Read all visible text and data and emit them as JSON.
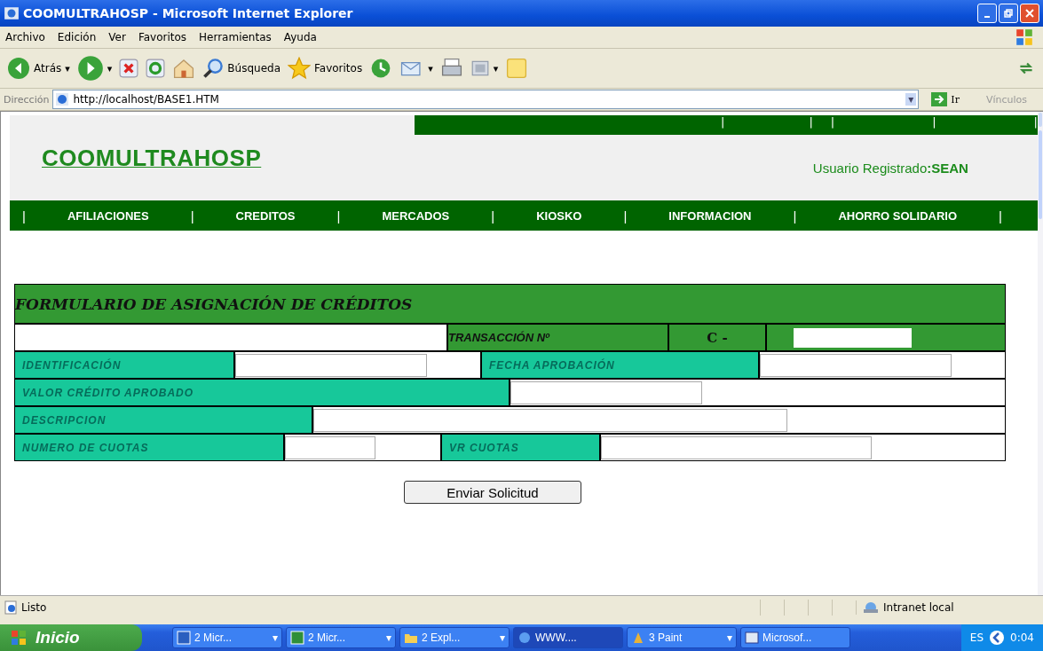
{
  "window": {
    "title": "COOMULTRAHOSP - Microsoft Internet Explorer"
  },
  "menu": [
    "Archivo",
    "Edición",
    "Ver",
    "Favoritos",
    "Herramientas",
    "Ayuda"
  ],
  "toolbar": {
    "back": "Atrás",
    "back_caret": "▾",
    "forward_caret": "▾",
    "search": "Búsqueda",
    "favorites": "Favoritos",
    "mail_caret": "▾",
    "window_caret": "▾"
  },
  "address": {
    "label": "Dirección",
    "value": "http://localhost/BASE1.HTM",
    "dropdown": "▾",
    "go": "Ir",
    "links": "Vínculos"
  },
  "page": {
    "logo": "COOMULTRAHOSP",
    "top_separators": [
      "|",
      "|",
      "|",
      "|",
      "|"
    ],
    "user_label": "Usuario Registrado",
    "user_colon": ":",
    "user_name": "SEAN",
    "nav": [
      {
        "kind": "separator",
        "text": "|"
      },
      {
        "kind": "link",
        "text": "AFILIACIONES"
      },
      {
        "kind": "separator",
        "text": "|"
      },
      {
        "kind": "link",
        "text": "CREDITOS"
      },
      {
        "kind": "separator",
        "text": "|"
      },
      {
        "kind": "link",
        "text": "MERCADOS"
      },
      {
        "kind": "separator",
        "text": "|"
      },
      {
        "kind": "link",
        "text": "KIOSKO"
      },
      {
        "kind": "separator",
        "text": "|"
      },
      {
        "kind": "link",
        "text": "INFORMACION"
      },
      {
        "kind": "separator",
        "text": "|"
      },
      {
        "kind": "link",
        "text": "AHORRO SOLIDARIO"
      },
      {
        "kind": "separator",
        "text": "|"
      }
    ],
    "form": {
      "title": "FORMULARIO DE ASIGNACIÓN DE CRÉDITOS",
      "transaction_label": "TRANSACCIÓN Nº",
      "transaction_prefix": "C -",
      "fields": [
        {
          "label": "IDENTIFICACIÓN"
        },
        {
          "label": "FECHA APROBACIÓN"
        },
        {
          "label": "VALOR CRÉDITO APROBADO"
        },
        {
          "label": "DESCRIPCION"
        },
        {
          "label": "NUMERO DE CUOTAS"
        },
        {
          "label": "VR CUOTAS"
        }
      ],
      "submit": "Enviar Solicitud"
    }
  },
  "status_bar": {
    "text": "Listo",
    "zone": "Intranet local"
  },
  "taskbar": {
    "start": "Inicio",
    "items": [
      {
        "kind": "word",
        "label": "2 Micr...",
        "caret": "▾",
        "selected": false
      },
      {
        "kind": "excel",
        "label": "2 Micr...",
        "caret": "▾",
        "selected": false
      },
      {
        "kind": "folder",
        "label": "2 Expl...",
        "caret": "▾",
        "selected": false
      },
      {
        "kind": "ie",
        "label": "WWW....",
        "selected": true
      },
      {
        "kind": "paint",
        "label": "3 Paint",
        "caret": "▾",
        "selected": false
      },
      {
        "kind": "app",
        "label": "Microsof...",
        "selected": false
      }
    ],
    "lang": "ES",
    "clock": "0:04"
  }
}
